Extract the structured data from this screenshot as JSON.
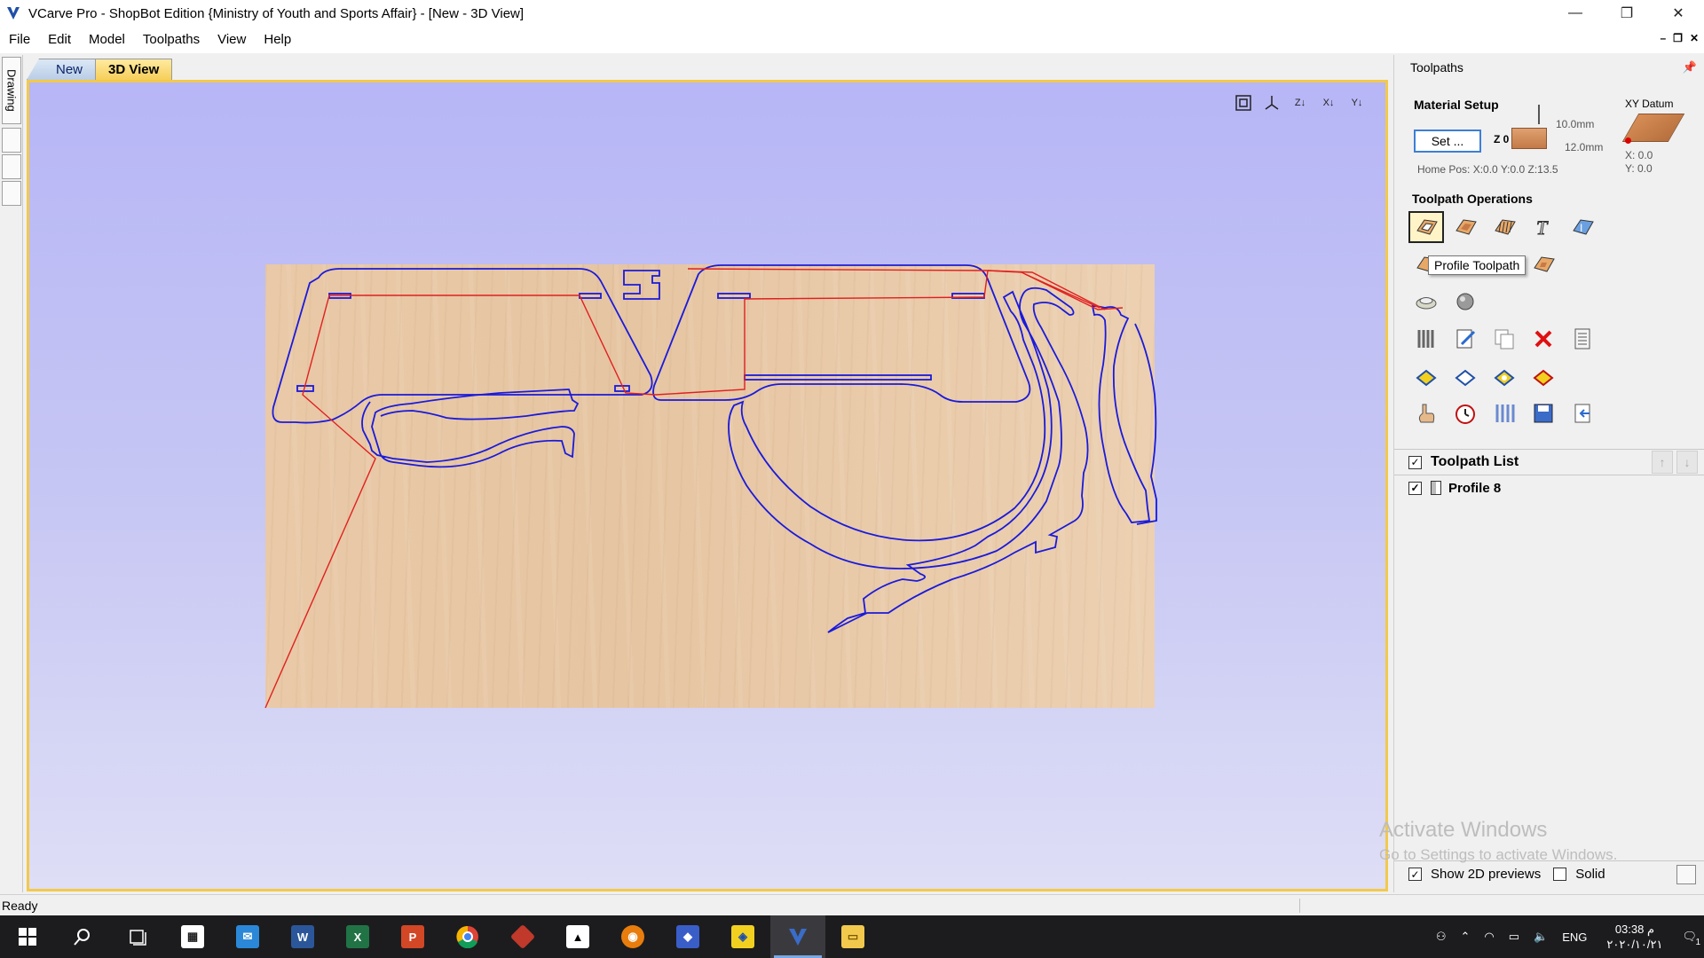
{
  "window": {
    "title": "VCarve Pro - ShopBot Edition {Ministry of Youth and Sports Affair} - [New - 3D View]",
    "controls": [
      "—",
      "❐",
      "✕"
    ]
  },
  "menu": {
    "items": [
      "File",
      "Edit",
      "Model",
      "Toolpaths",
      "View",
      "Help"
    ],
    "mdi_controls": [
      "–",
      "❐",
      "✕"
    ]
  },
  "left_strip": {
    "drawing_tab": "Drawing"
  },
  "doc_tabs": [
    {
      "label": "New",
      "active": false
    },
    {
      "label": "3D View",
      "active": true
    }
  ],
  "view_toolbar": [
    "fit-view-icon",
    "iso-view-icon",
    "z-view-icon",
    "x-view-icon",
    "y-view-icon"
  ],
  "view_toolbar_labels": [
    "",
    "",
    "Z",
    "X",
    "Y"
  ],
  "right_panel": {
    "title": "Toolpaths",
    "material_setup": {
      "title": "Material Setup",
      "set_label": "Set ...",
      "z0_label": "Z 0",
      "thickness_top": "10.0mm",
      "thickness_bottom": "12.0mm",
      "home_pos": "Home Pos:  X:0.0 Y:0.0 Z:13.5"
    },
    "xy_datum": {
      "title": "XY Datum",
      "x": "X: 0.0",
      "y": "Y: 0.0"
    },
    "operations_title": "Toolpath Operations",
    "tooltip": "Profile Toolpath",
    "toolpath_list": {
      "title": "Toolpath List",
      "items": [
        {
          "name": "Profile 8",
          "checked": true
        }
      ]
    },
    "footer": {
      "show_2d_previews": "Show 2D previews",
      "solid": "Solid"
    }
  },
  "watermark": {
    "title": "Activate Windows",
    "subtitle": "Go to Settings to activate Windows."
  },
  "status": {
    "text": "Ready"
  },
  "taskbar": {
    "apps": [
      "start-icon",
      "search-icon",
      "task-view-icon",
      "store-icon",
      "mail-icon",
      "word-icon",
      "excel-icon",
      "powerpoint-icon",
      "chrome-icon",
      "app-red-icon",
      "inkscape-icon",
      "blender-icon",
      "app-blue-icon",
      "app-doc-icon",
      "vcarve-icon",
      "file-explorer-icon"
    ],
    "app_labels": [
      "",
      "",
      "",
      "",
      "",
      "W",
      "X",
      "P",
      "",
      "",
      "",
      "",
      "",
      "",
      "",
      ""
    ],
    "language": "ENG",
    "time": "03:38 م",
    "date": "٢٠٢٠/١٠/٢١",
    "notification_count": "1"
  },
  "colors": {
    "viewport_border": "#f3c94c",
    "vector_blue": "#1a1adb",
    "rapid_red": "#e02020",
    "accent": "#3c7fd6"
  }
}
